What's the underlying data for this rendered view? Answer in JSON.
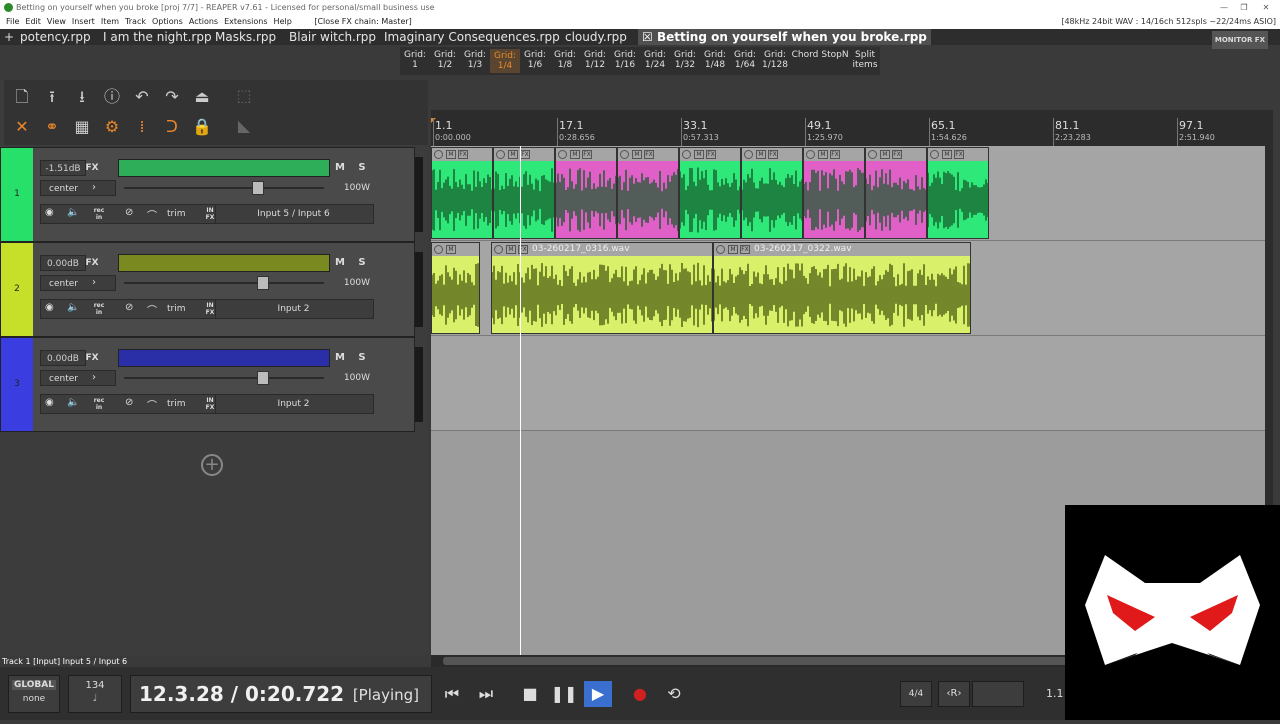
{
  "window": {
    "title": "Betting on yourself when you broke [proj 7/7] - REAPER v7.61 - Licensed for personal/small business use",
    "minimize_icon": "minimize-icon",
    "restore_icon": "restore-icon",
    "close_icon": "close-icon"
  },
  "menu": {
    "items": [
      "File",
      "Edit",
      "View",
      "Insert",
      "Item",
      "Track",
      "Options",
      "Actions",
      "Extensions",
      "Help"
    ],
    "fx_chain": "[Close FX chain: Master]",
    "audio_status": "[48kHz 24bit WAV : 14/16ch 512spls ~22/24ms ASIO]"
  },
  "tabs": {
    "items": [
      "potency.rpp",
      "I am the night.rpp",
      "Masks.rpp",
      "Blair witch.rpp",
      "Imaginary Consequences.rpp",
      "cloudy.rpp",
      "Betting on yourself when you broke.rpp"
    ],
    "active_index": 6,
    "monitor_fx": "MONITOR FX"
  },
  "gridbar": {
    "buttons": [
      [
        "Grid:",
        "1"
      ],
      [
        "Grid:",
        "1/2"
      ],
      [
        "Grid:",
        "1/3"
      ],
      [
        "Grid:",
        "1/4"
      ],
      [
        "Grid:",
        "1/6"
      ],
      [
        "Grid:",
        "1/8"
      ],
      [
        "Grid:",
        "1/12"
      ],
      [
        "Grid:",
        "1/16"
      ],
      [
        "Grid:",
        "1/24"
      ],
      [
        "Grid:",
        "1/32"
      ],
      [
        "Grid:",
        "1/48"
      ],
      [
        "Grid:",
        "1/64"
      ],
      [
        "Grid:",
        "1/128"
      ],
      [
        "Chord",
        ""
      ],
      [
        "StopN",
        ""
      ],
      [
        "Split",
        "items"
      ]
    ],
    "active_index": 3
  },
  "toolbar": {
    "row1": [
      "new-project-icon",
      "upload-icon",
      "download-icon",
      "info-icon",
      "undo-icon",
      "redo-icon",
      "metronome-icon"
    ],
    "row2": [
      "ripple-icon",
      "link-icon",
      "grid-icon",
      "envelope-icon",
      "snap-dots-icon",
      "snap-magnet-icon",
      "lock-icon"
    ]
  },
  "tracks": [
    {
      "number": "1",
      "volume": "-1.51dB",
      "pan": "center",
      "width": "100W",
      "input": "Input 5 / Input 6",
      "color": "#27e06a",
      "name_color": "#2fae5a",
      "fader_pos": 0.68
    },
    {
      "number": "2",
      "volume": "0.00dB",
      "pan": "center",
      "width": "100W",
      "input": "Input 2",
      "color": "#c6e02a",
      "name_color": "#7a8a20",
      "fader_pos": 0.71
    },
    {
      "number": "3",
      "volume": "0.00dB",
      "pan": "center",
      "width": "100W",
      "input": "Input 2",
      "color": "#3a3ee0",
      "name_color": "#2a2fa8",
      "fader_pos": 0.71
    }
  ],
  "track_labels": {
    "fx": "FX",
    "mute": "M",
    "solo": "S",
    "trim": "trim",
    "rec_in": [
      "rec",
      "in"
    ],
    "in_fx": [
      "IN",
      "FX"
    ]
  },
  "ruler": {
    "marks": [
      {
        "bar": "1.1",
        "time": "0:00.000"
      },
      {
        "bar": "17.1",
        "time": "0:28.656"
      },
      {
        "bar": "33.1",
        "time": "0:57.313"
      },
      {
        "bar": "49.1",
        "time": "1:25.970"
      },
      {
        "bar": "65.1",
        "time": "1:54.626"
      },
      {
        "bar": "81.1",
        "time": "2:23.283"
      },
      {
        "bar": "97.1",
        "time": "2:51.940"
      }
    ]
  },
  "items": {
    "track2_files": [
      "03-260217_0316.wav",
      "03-260217_0322.wav"
    ],
    "track1_colors": [
      "#2ee87a",
      "#2ee87a",
      "#e060c8",
      "#e060c8",
      "#2ee87a",
      "#2ee87a",
      "#e060c8",
      "#e060c8",
      "#2ee87a"
    ]
  },
  "status": {
    "text": "Track 1 [Input] Input 5 / Input 6"
  },
  "transport": {
    "global_label": "GLOBAL",
    "global_value": "none",
    "bpm": "134",
    "position": "12.3.28 / 0:20.722",
    "state": "[Playing]",
    "time_sig": "4/4",
    "region": "‹R›",
    "selection": "1.1"
  },
  "add_track_icon": "plus-circle-icon",
  "logo": {
    "icon": "mask-logo-icon"
  }
}
